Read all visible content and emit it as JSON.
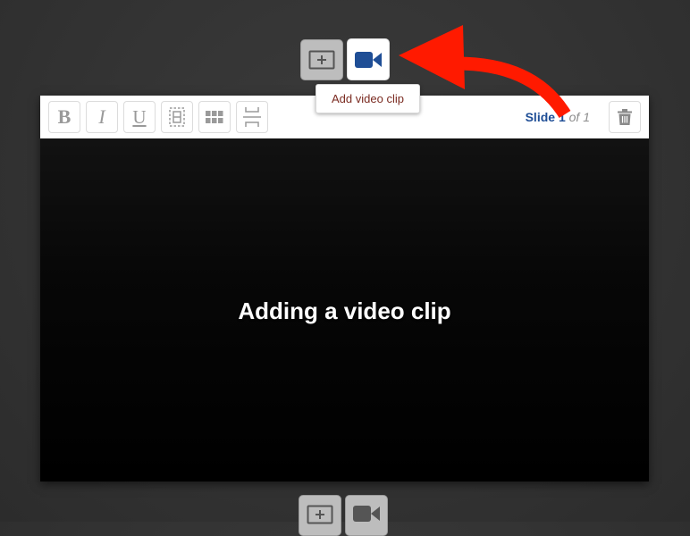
{
  "top_buttons": {
    "add_slide_icon": "add-slide-icon",
    "add_video_icon": "video-camera-icon",
    "add_video_color": "#1f4e96"
  },
  "tooltip": {
    "text": "Add video clip"
  },
  "toolbar": {
    "bold_label": "B",
    "italic_label": "I",
    "underline_label": "U",
    "frame_icon": "frame-icon",
    "grid_icon": "grid-icon",
    "split_icon": "split-icon",
    "trash_icon": "trash-icon"
  },
  "slide_counter": {
    "word": "Slide",
    "current": "1",
    "total_text": "of 1"
  },
  "slide": {
    "title": "Adding a video clip"
  },
  "annotation": {
    "arrow_color": "#ff1a00"
  },
  "bottom_buttons": {
    "add_slide_icon": "add-slide-icon",
    "add_video_icon": "video-camera-icon"
  }
}
